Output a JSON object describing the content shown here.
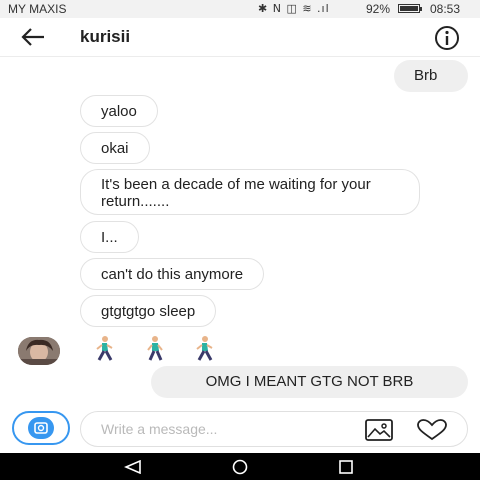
{
  "status_bar": {
    "carrier": "MY MAXIS",
    "icons": "✱ N ◫ ≋ .ıl",
    "battery": "92%",
    "time": "08:53"
  },
  "header": {
    "title": "kurisii",
    "back_icon": "arrow-left-icon",
    "info_icon": "info-icon"
  },
  "messages": [
    {
      "from": "me",
      "text": "Brb"
    },
    {
      "from": "them",
      "text": "yaloo"
    },
    {
      "from": "them",
      "text": "okai"
    },
    {
      "from": "them",
      "text": "It's been a decade of me waiting for your return......."
    },
    {
      "from": "them",
      "text": "I..."
    },
    {
      "from": "them",
      "text": "can't do this anymore"
    },
    {
      "from": "them",
      "text": "gtgtgtgo sleep"
    },
    {
      "from": "them",
      "emoji": [
        "running-person-icon",
        "running-person-icon",
        "running-person-icon"
      ]
    },
    {
      "from": "me",
      "text": "OMG I MEANT GTG NOT BRB"
    }
  ],
  "composer": {
    "placeholder": "Write a message...",
    "camera_icon": "camera-icon",
    "gallery_icon": "image-icon",
    "like_icon": "heart-icon"
  },
  "nav_bar": {
    "icons": [
      "back-triangle-icon",
      "home-circle-icon",
      "recents-square-icon"
    ]
  },
  "colors": {
    "accent": "#3797f0",
    "incoming_border": "#e2e2e2",
    "outgoing_bg": "#efefef"
  }
}
